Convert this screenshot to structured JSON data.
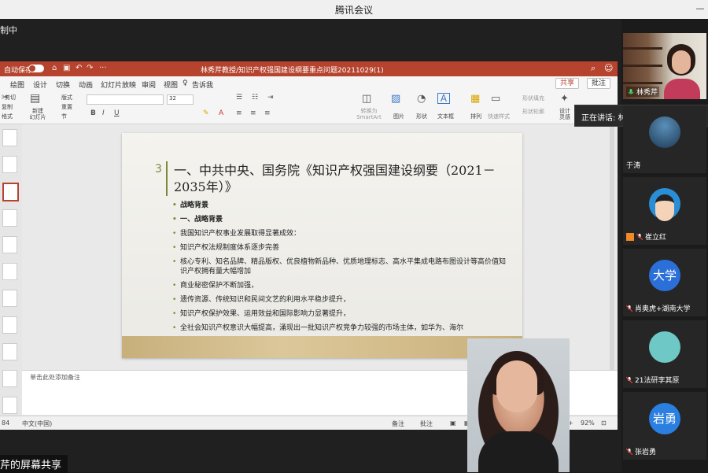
{
  "app": {
    "title": "腾讯会议"
  },
  "share": {
    "top_label": "制中",
    "bottom_label": "芹的屏幕共享"
  },
  "ppt": {
    "autosave": "自动保存",
    "doc_title": "林秀芹教授/知识产权强国建设纲要重点问题20211029(1)",
    "menu": [
      "绘图",
      "设计",
      "切换",
      "动画",
      "幻灯片放映",
      "审阅",
      "视图",
      "告诉我"
    ],
    "share_btn": "共享",
    "comment_btn": "批注",
    "ribbon": {
      "cut": "剪切",
      "copy": "复制",
      "format": "格式",
      "new_slide": "新建\n幻灯片",
      "layout": "版式",
      "reset": "重置",
      "section": "节",
      "font_size": "32",
      "convert_smartart": "转换为\nSmartArt",
      "picture": "图片",
      "shape": "形状",
      "textbox": "文本框",
      "arrange": "排列",
      "quick_style": "快速样式",
      "shape_fill": "形状填充",
      "shape_outline": "形状轮廓",
      "design_ideas": "设计\n灵感"
    },
    "slide": {
      "number": "3",
      "title": "一、中共中央、国务院《知识产权强国建设纲要（2021－2035年）》",
      "bullets": [
        {
          "text": "战略背景",
          "style": "b"
        },
        {
          "text": "一、战略背景",
          "style": "b"
        },
        {
          "text": "",
          "style": ""
        },
        {
          "text": "我国知识产权事业发展取得显著成效：",
          "style": "nb"
        },
        {
          "text": "知识产权法规制度体系逐步完善",
          "style": ""
        },
        {
          "text": "核心专利、知名品牌、精品版权、优良植物新品种、优质地理标志、高水平集成电路布图设计等高价值知识产权拥有量大幅增加",
          "style": ""
        },
        {
          "text": "商业秘密保护不断加强，",
          "style": ""
        },
        {
          "text": "遗传资源、传统知识和民间文艺的利用水平稳步提升，",
          "style": ""
        },
        {
          "text": "知识产权保护效果、运用效益和国际影响力显著提升，",
          "style": ""
        },
        {
          "text": "全社会知识产权意识大幅提高，涌现出一批知识产权竞争力较强的市场主体，如华为、海尔",
          "style": ""
        }
      ]
    },
    "notes_placeholder": "单击此处添加备注",
    "status": {
      "slide_info": "84",
      "language": "中文(中国)",
      "notes": "备注",
      "comments": "批注",
      "zoom": "92%"
    }
  },
  "participants": [
    {
      "name": "林秀芹",
      "type": "camera"
    },
    {
      "name": "于涛",
      "type": "avatar",
      "avatar_color": "#1e5a8a"
    },
    {
      "name": "崔立红",
      "type": "avatar",
      "avatar_color": "#2a8ed6"
    },
    {
      "name": "肖奥虎+湖南大学",
      "type": "avatar",
      "avatar_color": "#2b6fd9",
      "avatar_text": "大学"
    },
    {
      "name": "21法研李其原",
      "type": "avatar",
      "avatar_color": "#6ec8c6"
    },
    {
      "name": "张岩勇",
      "type": "avatar",
      "avatar_color": "#2a7fe0",
      "avatar_text": "岩勇"
    }
  ],
  "speaking": {
    "label": "正在讲话: 林秀芹;"
  },
  "colors": {
    "ppt_accent": "#b5432e",
    "slide_accent": "#7a8a3a"
  }
}
